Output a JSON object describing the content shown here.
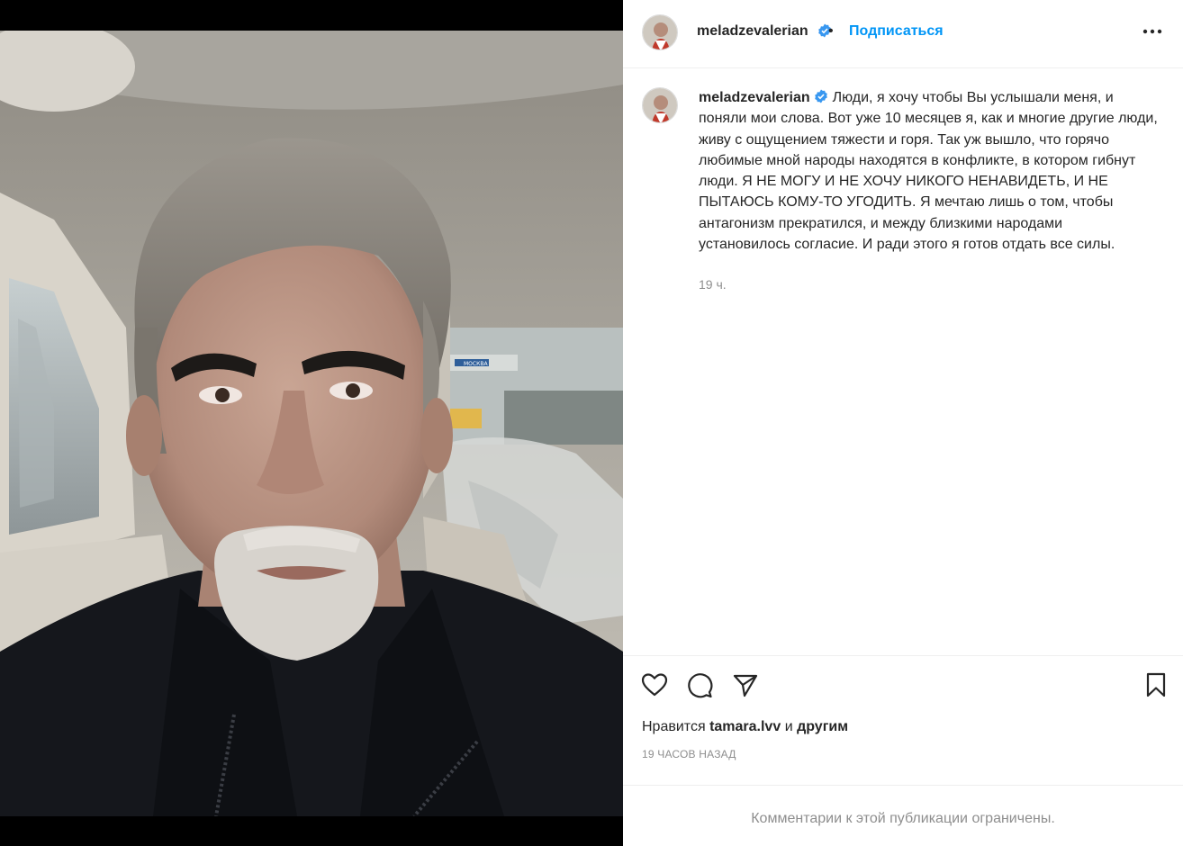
{
  "post": {
    "username": "meladzevalerian",
    "follow_label": "Подписаться",
    "dot": "•",
    "caption": "Люди, я хочу чтобы Вы услышали меня, и поняли мои слова. Вот уже 10 месяцев я, как и многие другие люди, живу с ощущением тяжести и горя. Так уж вышло, что горячо любимые мной народы находятся в конфликте, в котором гибнут люди. Я НЕ МОГУ И НЕ ХОЧУ НИКОГО НЕНАВИДЕТЬ, И НЕ ПЫТАЮСЬ КОМУ-ТО УГОДИТЬ. Я мечтаю лишь о том, чтобы антагонизм прекратился, и между близкими народами установилось согласие. И ради этого я готов отдать все силы.",
    "caption_time": "19 ч.",
    "likes_prefix": "Нравится",
    "likes_user": "tamara.lvv",
    "likes_and": "и",
    "likes_others": "другим",
    "time_ago": "19 ЧАСОВ НАЗАД",
    "comments_limited": "Комментарии к этой публикации ограничены."
  },
  "icons": {
    "verified": "verified-badge-icon",
    "more": "more-options-icon",
    "like": "heart-icon",
    "comment": "comment-icon",
    "share": "paper-plane-icon",
    "save": "bookmark-icon"
  },
  "colors": {
    "accent": "#0095f6",
    "text": "#262626",
    "muted": "#8e8e8e",
    "border": "#efefef",
    "verified": "#3897f0"
  },
  "photo": {
    "sign_text": "МОСКВА"
  }
}
